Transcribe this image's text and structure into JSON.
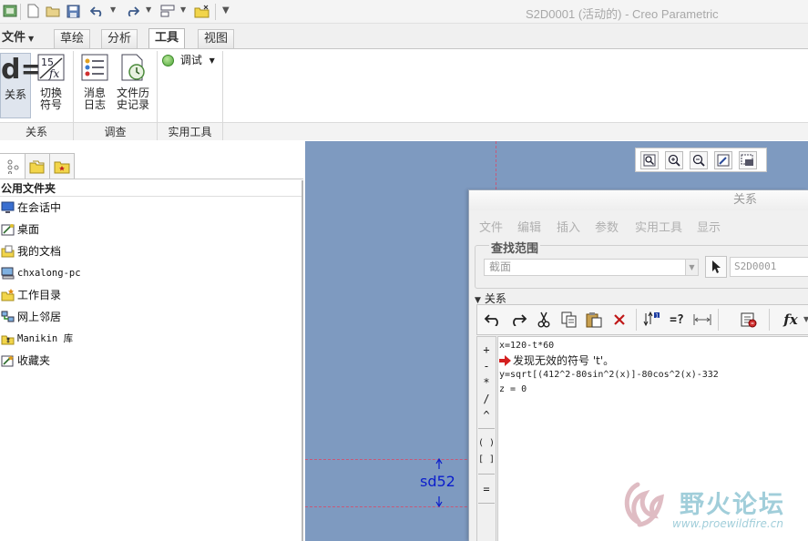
{
  "window": {
    "title": "S2D0001 (活动的) - Creo Parametric"
  },
  "ribbon_tabs": [
    {
      "label": "文件"
    },
    {
      "label": "草绘"
    },
    {
      "label": "分析"
    },
    {
      "label": "工具",
      "active": true
    },
    {
      "label": "视图"
    }
  ],
  "ribbon": {
    "buttons": {
      "relations": "关系",
      "switch_symbols_1": "切换",
      "switch_symbols_2": "符号",
      "message_log_1": "消息",
      "message_log_2": "日志",
      "file_history_1": "文件历",
      "file_history_2": "史记录",
      "debug": "调试"
    },
    "groups": {
      "relations": "关系",
      "investigate": "调查",
      "utilities": "实用工具"
    }
  },
  "navigator": {
    "header": "公用文件夹",
    "items": [
      {
        "label": "在会话中",
        "icon": "monitor-icon"
      },
      {
        "label": "桌面",
        "icon": "desktop-icon"
      },
      {
        "label": "我的文档",
        "icon": "documents-folder-icon"
      },
      {
        "label": "chxalong-pc",
        "icon": "computer-icon"
      },
      {
        "label": "工作目录",
        "icon": "working-folder-icon"
      },
      {
        "label": "网上邻居",
        "icon": "network-icon"
      },
      {
        "label": "Manikin 库",
        "icon": "manikin-library-icon"
      },
      {
        "label": "收藏夹",
        "icon": "favorites-icon"
      }
    ]
  },
  "graphics": {
    "dimension_label": "sd52"
  },
  "relations_dialog": {
    "title": "关系",
    "menu": [
      "文件",
      "编辑",
      "插入",
      "参数",
      "实用工具",
      "显示"
    ],
    "scope_label": "查找范围",
    "scope_value": "截面",
    "scope_object": "S2D0001",
    "section_label": "关系",
    "operators": [
      "+",
      "-",
      "*",
      "/",
      "^",
      "( )",
      "[ ]",
      "="
    ],
    "editor_lines": [
      "x=120-t*60",
      "发现无效的符号 't'。",
      "y=sqrt[(412^2-80sin^2(x)]-80cos^2(x)-332",
      "z = 0"
    ]
  },
  "watermark": {
    "text": "野火论坛",
    "url": "www.proewildfire.cn"
  },
  "colors": {
    "graphics_background": "#7e9ac0",
    "dimension_text": "#0b1ecc",
    "error_arrow": "#d42020",
    "watermark": "#82becd"
  }
}
